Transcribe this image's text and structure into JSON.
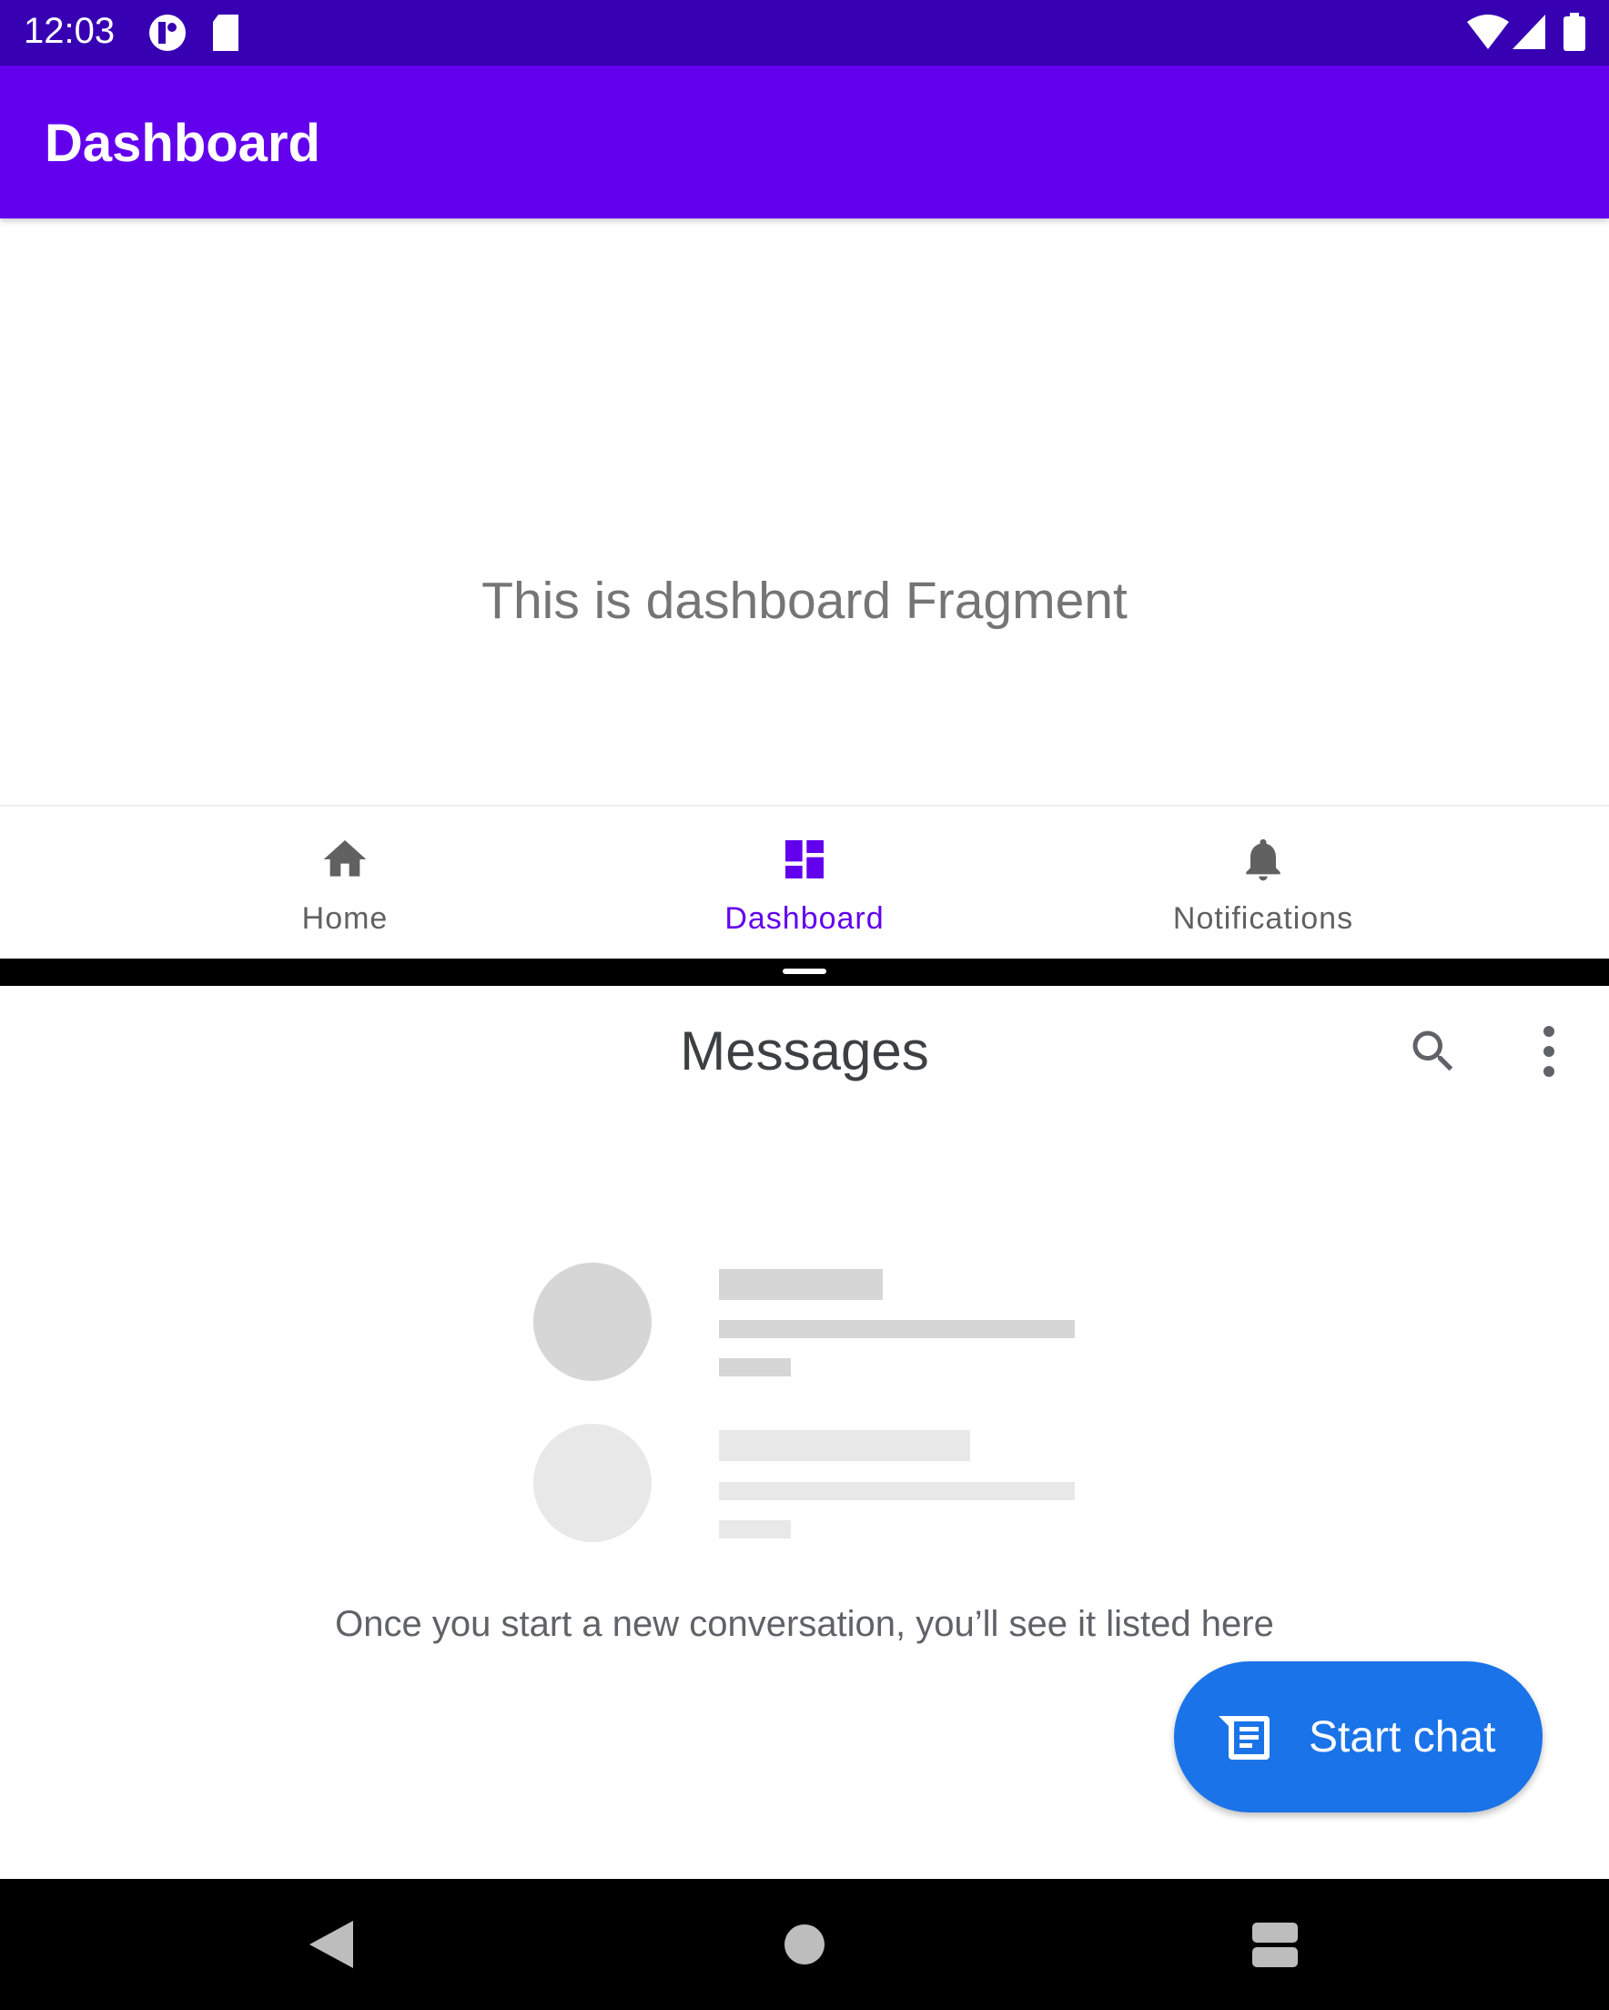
{
  "status_bar": {
    "time": "12:03"
  },
  "app_bar": {
    "title": "Dashboard"
  },
  "content": {
    "text": "This is dashboard Fragment"
  },
  "bottom_nav": {
    "items": [
      {
        "label": "Home",
        "icon": "home-icon"
      },
      {
        "label": "Dashboard",
        "icon": "dashboard-icon",
        "selected": true
      },
      {
        "label": "Notifications",
        "icon": "bell-icon"
      }
    ]
  },
  "messages": {
    "title": "Messages",
    "empty_text": "Once you start a new conversation, you’ll see it listed here",
    "fab_label": "Start chat"
  },
  "colors": {
    "status": "#3700b3",
    "primary": "#6200ee",
    "fab": "#1a73e8"
  }
}
